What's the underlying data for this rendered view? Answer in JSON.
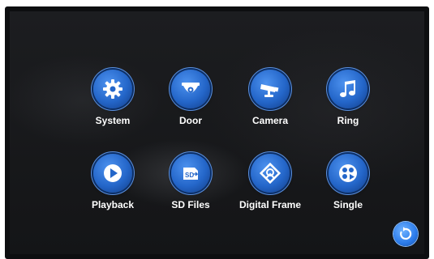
{
  "menu": {
    "items": [
      {
        "label": "System",
        "icon": "gear-icon"
      },
      {
        "label": "Door",
        "icon": "dome-camera-icon"
      },
      {
        "label": "Camera",
        "icon": "security-camera-icon"
      },
      {
        "label": "Ring",
        "icon": "music-note-icon"
      },
      {
        "label": "Playback",
        "icon": "play-icon"
      },
      {
        "label": "SD Files",
        "icon": "sd-card-icon"
      },
      {
        "label": "Digital Frame",
        "icon": "photo-frame-icon"
      },
      {
        "label": "Single",
        "icon": "film-reel-icon"
      }
    ]
  },
  "back_button": {
    "icon": "return-icon"
  },
  "colors": {
    "accent": "#2466c9",
    "background": "#141517",
    "text": "#ffffff"
  }
}
